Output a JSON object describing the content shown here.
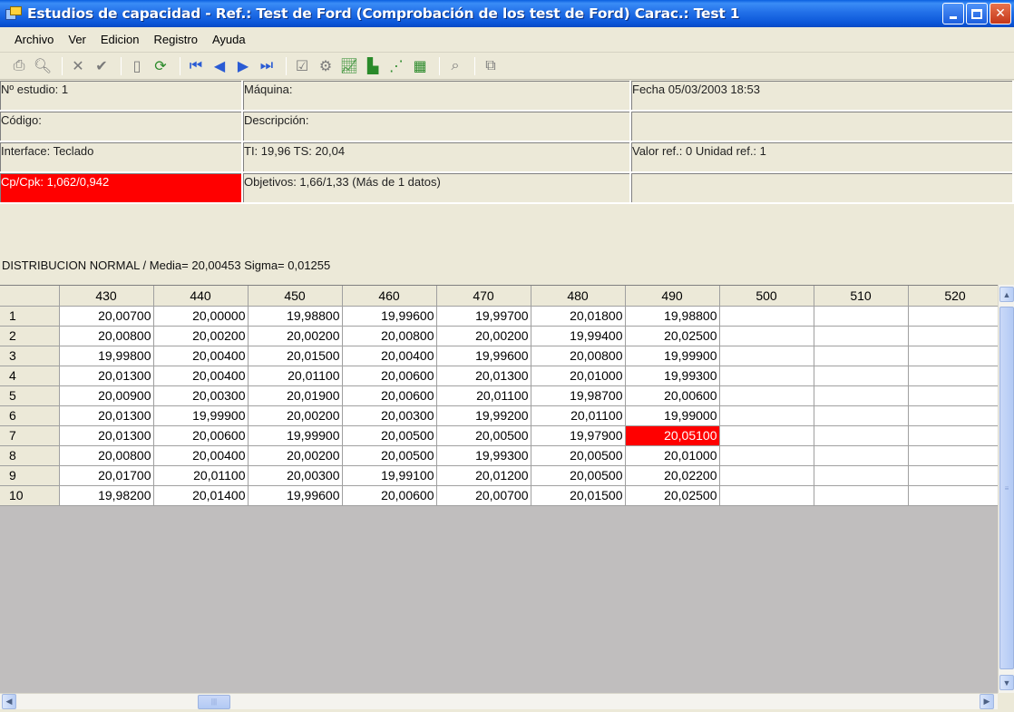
{
  "window": {
    "title": "Estudios de capacidad  - Ref.: Test de Ford (Comprobación de los test de Ford)  Carac.: Test 1"
  },
  "menu": [
    "Archivo",
    "Ver",
    "Edicion",
    "Registro",
    "Ayuda"
  ],
  "toolbar": {
    "icons": [
      "print-icon",
      "print-preview-icon",
      "delete-icon",
      "confirm-icon",
      "new-icon",
      "refresh-icon",
      "first-record-icon",
      "previous-record-icon",
      "next-record-icon",
      "last-record-icon",
      "properties-icon",
      "settings-icon",
      "run-chart-icon",
      "histogram-icon",
      "scatter-chart-icon",
      "control-chart-icon",
      "zoom-icon",
      "export-icon"
    ]
  },
  "info": {
    "estudio": "Nº estudio: 1",
    "maquina": "Máquina:",
    "fecha": "Fecha 05/03/2003 18:53",
    "codigo": "Código:",
    "descripcion": "Descripción:",
    "empty1": "",
    "interface": "Interface: Teclado",
    "tolerancias": "TI: 19,96 TS: 20,04",
    "valor_ref": "Valor ref.: 0 Unidad ref.: 1",
    "cpcpk": "Cp/Cpk: 1,062/0,942",
    "objetivos": "Objetivos: 1,66/1,33 (Más de 1 datos)",
    "empty2": "",
    "distribucion": "DISTRIBUCION NORMAL / Media= 20,00453 Sigma= 0,01255"
  },
  "grid": {
    "columns": [
      "430",
      "440",
      "450",
      "460",
      "470",
      "480",
      "490",
      "500",
      "510",
      "520"
    ],
    "rows": [
      {
        "n": "1",
        "v": [
          "20,00700",
          "20,00000",
          "19,98800",
          "19,99600",
          "19,99700",
          "20,01800",
          "19,98800",
          "",
          "",
          ""
        ]
      },
      {
        "n": "2",
        "v": [
          "20,00800",
          "20,00200",
          "20,00200",
          "20,00800",
          "20,00200",
          "19,99400",
          "20,02500",
          "",
          "",
          ""
        ]
      },
      {
        "n": "3",
        "v": [
          "19,99800",
          "20,00400",
          "20,01500",
          "20,00400",
          "19,99600",
          "20,00800",
          "19,99900",
          "",
          "",
          ""
        ]
      },
      {
        "n": "4",
        "v": [
          "20,01300",
          "20,00400",
          "20,01100",
          "20,00600",
          "20,01300",
          "20,01000",
          "19,99300",
          "",
          "",
          ""
        ]
      },
      {
        "n": "5",
        "v": [
          "20,00900",
          "20,00300",
          "20,01900",
          "20,00600",
          "20,01100",
          "19,98700",
          "20,00600",
          "",
          "",
          ""
        ]
      },
      {
        "n": "6",
        "v": [
          "20,01300",
          "19,99900",
          "20,00200",
          "20,00300",
          "19,99200",
          "20,01100",
          "19,99000",
          "",
          "",
          ""
        ]
      },
      {
        "n": "7",
        "v": [
          "20,01300",
          "20,00600",
          "19,99900",
          "20,00500",
          "20,00500",
          "19,97900",
          "20,05100",
          "",
          "",
          ""
        ]
      },
      {
        "n": "8",
        "v": [
          "20,00800",
          "20,00400",
          "20,00200",
          "20,00500",
          "19,99300",
          "20,00500",
          "20,01000",
          "",
          "",
          ""
        ]
      },
      {
        "n": "9",
        "v": [
          "20,01700",
          "20,01100",
          "20,00300",
          "19,99100",
          "20,01200",
          "20,00500",
          "20,02200",
          "",
          "",
          ""
        ]
      },
      {
        "n": "10",
        "v": [
          "19,98200",
          "20,01400",
          "19,99600",
          "20,00600",
          "20,00700",
          "20,01500",
          "20,02500",
          "",
          "",
          ""
        ]
      }
    ],
    "flagged_color": "#ff0000"
  }
}
